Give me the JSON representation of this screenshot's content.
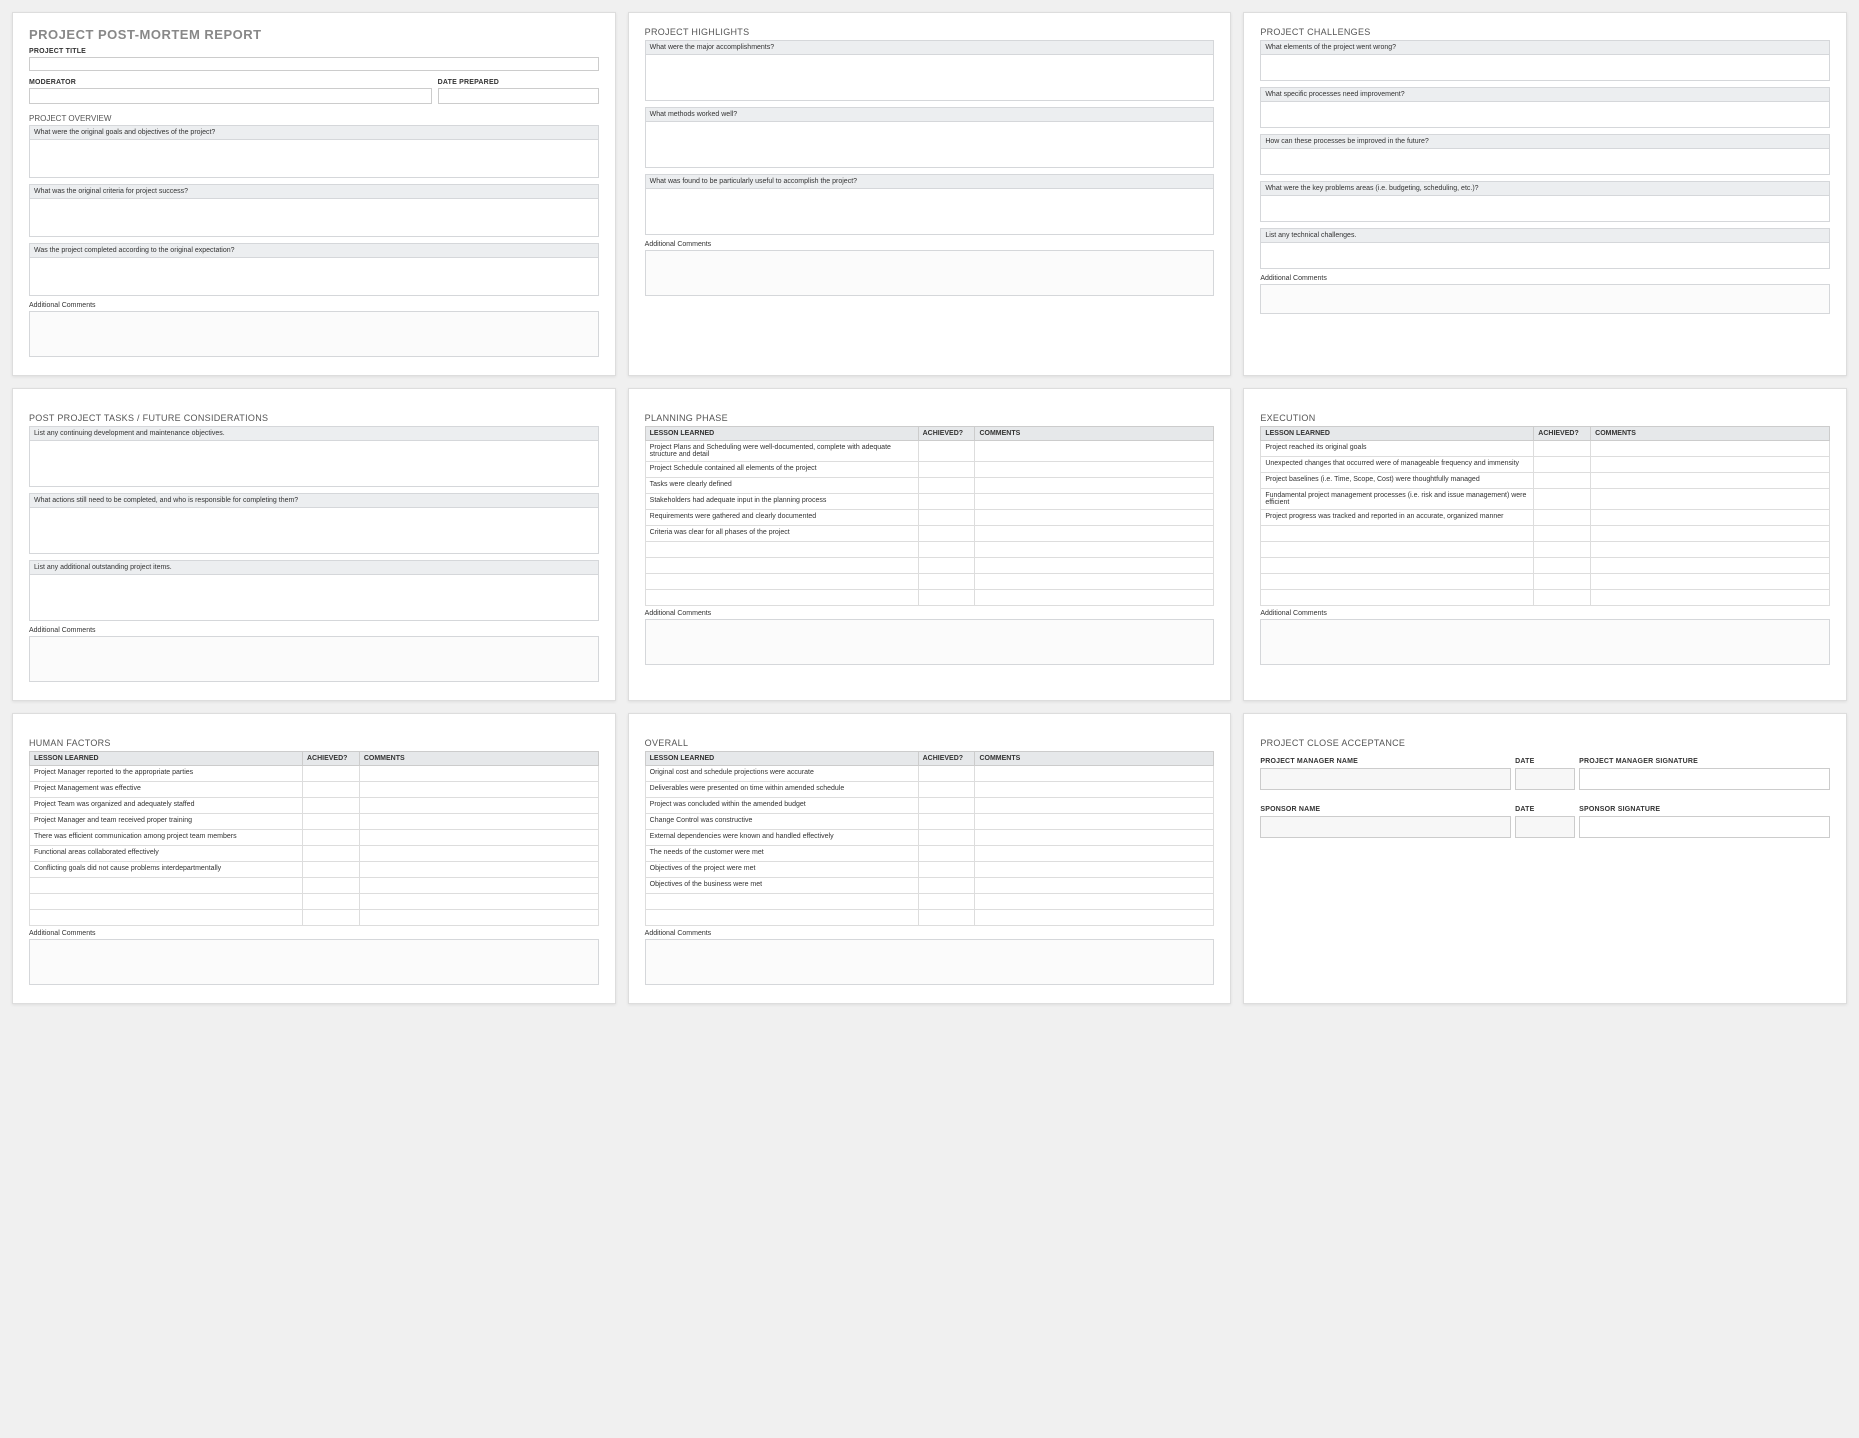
{
  "titles": {
    "main": "PROJECT POST-MORTEM REPORT",
    "project_title": "PROJECT TITLE",
    "moderator": "MODERATOR",
    "date_prepared": "DATE PREPARED",
    "project_overview": "PROJECT OVERVIEW",
    "additional_comments": "Additional Comments"
  },
  "overview": {
    "q1": "What were the original goals and objectives of the project?",
    "q2": "What was the original criteria for project success?",
    "q3": "Was the project completed according to the original expectation?"
  },
  "highlights": {
    "title": "PROJECT HIGHLIGHTS",
    "q1": "What were the major accomplishments?",
    "q2": "What methods worked well?",
    "q3": "What was found to be particularly useful to accomplish the project?"
  },
  "challenges": {
    "title": "PROJECT CHALLENGES",
    "q1": "What elements of the project went wrong?",
    "q2": "What specific processes need improvement?",
    "q3": "How can these processes be improved in the future?",
    "q4": "What were the key problems areas (i.e. budgeting, scheduling, etc.)?",
    "q5": "List any technical challenges."
  },
  "postproject": {
    "title": "POST PROJECT TASKS / FUTURE CONSIDERATIONS",
    "q1": "List any continuing development and maintenance objectives.",
    "q2": "What actions still need to be completed, and who is responsible for completing them?",
    "q3": "List any additional outstanding project items."
  },
  "table_headers": {
    "lesson": "LESSON LEARNED",
    "achieved": "ACHIEVED?",
    "comments": "COMMENTS"
  },
  "planning": {
    "title": "PLANNING PHASE",
    "rows": [
      "Project Plans and Scheduling were well-documented, complete with adequate structure and detail",
      "Project Schedule contained all elements of the project",
      "Tasks were clearly defined",
      "Stakeholders had adequate input in the planning process",
      "Requirements were gathered and clearly documented",
      "Criteria was clear for all phases of the project",
      "",
      "",
      "",
      ""
    ]
  },
  "execution": {
    "title": "EXECUTION",
    "rows": [
      "Project reached its original goals",
      "Unexpected changes that occurred were of manageable frequency and immensity",
      "Project baselines (i.e. Time, Scope, Cost) were thoughtfully managed",
      "Fundamental project management processes (i.e. risk and issue management) were efficient",
      "Project progress was tracked and reported in an accurate, organized manner",
      "",
      "",
      "",
      "",
      ""
    ]
  },
  "human": {
    "title": "HUMAN FACTORS",
    "rows": [
      "Project Manager reported to the appropriate parties",
      "Project Management was effective",
      "Project Team was organized and adequately staffed",
      "Project Manager and team received proper training",
      "There was efficient communication among project team members",
      "Functional areas collaborated effectively",
      "Conflicting goals did not cause problems interdepartmentally",
      "",
      "",
      ""
    ]
  },
  "overall": {
    "title": "OVERALL",
    "rows": [
      "Original cost and schedule projections were accurate",
      "Deliverables were presented on time within amended schedule",
      "Project was concluded within the amended budget",
      "Change Control was constructive",
      "External dependencies were known and handled effectively",
      "The needs of the customer were met",
      "Objectives of the project were met",
      "Objectives of the business were met",
      "",
      ""
    ]
  },
  "acceptance": {
    "title": "PROJECT CLOSE ACCEPTANCE",
    "pm_name": "PROJECT MANAGER NAME",
    "date": "DATE",
    "pm_sig": "PROJECT MANAGER SIGNATURE",
    "sponsor_name": "SPONSOR NAME",
    "sponsor_sig": "SPONSOR SIGNATURE"
  }
}
